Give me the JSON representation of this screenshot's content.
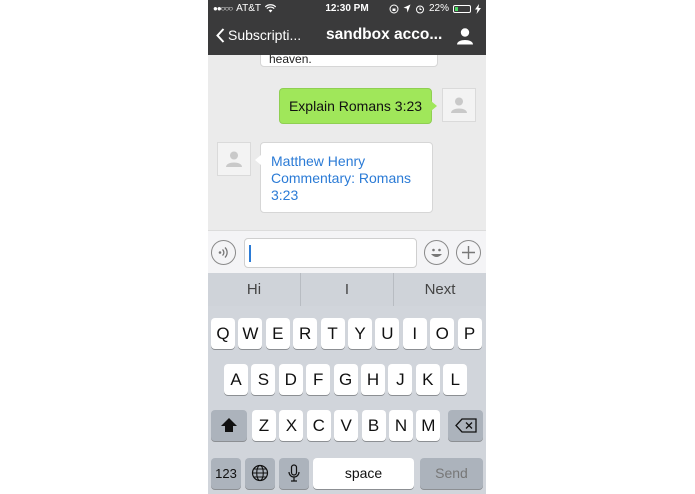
{
  "status_bar": {
    "carrier": "AT&T",
    "time": "12:30 PM",
    "battery": "22%",
    "battery_level": 0.22
  },
  "nav": {
    "back_label": "Subscripti...",
    "title": "sandbox acco..."
  },
  "messages": {
    "previous_partial": "heaven.",
    "outgoing": "Explain Romans 3:23",
    "incoming_link": "Matthew Henry Commentary: Romans 3:23"
  },
  "input": {
    "value": "",
    "placeholder": ""
  },
  "suggestions": [
    "Hi",
    "I",
    "Next"
  ],
  "keyboard": {
    "row1": [
      "Q",
      "W",
      "E",
      "R",
      "T",
      "Y",
      "U",
      "I",
      "O",
      "P"
    ],
    "row2": [
      "A",
      "S",
      "D",
      "F",
      "G",
      "H",
      "J",
      "K",
      "L"
    ],
    "row3": [
      "Z",
      "X",
      "C",
      "V",
      "B",
      "N",
      "M"
    ],
    "numbers_label": "123",
    "space_label": "space",
    "send_label": "Send"
  },
  "colors": {
    "nav_bg": "#3a3a3b",
    "outgoing_bubble": "#a0e75a",
    "link": "#2b7bd6",
    "battery_fill": "#4cd964"
  }
}
